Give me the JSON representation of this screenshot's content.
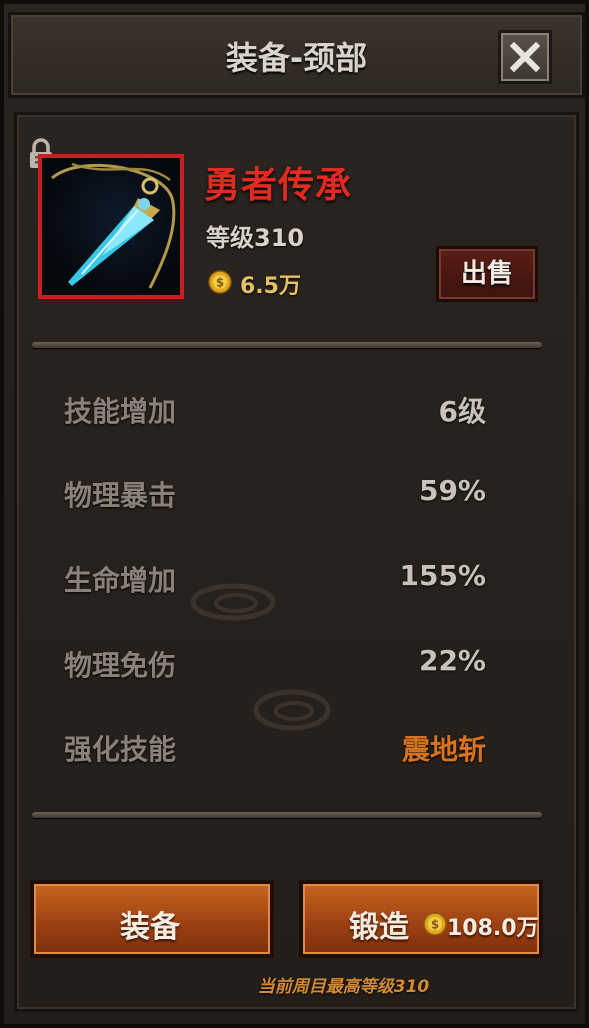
{
  "dialog": {
    "title": "装备-颈部"
  },
  "item": {
    "name": "勇者传承",
    "level": "等级310",
    "price": "6.5万",
    "name_color": "#e02a22",
    "frame_color": "#c82020",
    "icon": "crystal-pendant-icon"
  },
  "sell_label": "出售",
  "stats": [
    {
      "label": "技能增加",
      "value": "6级"
    },
    {
      "label": "物理暴击",
      "value": "59%"
    },
    {
      "label": "生命增加",
      "value": "155%"
    },
    {
      "label": "物理免伤",
      "value": "22%"
    },
    {
      "label": "强化技能",
      "value": "震地斩"
    }
  ],
  "buttons": {
    "equip_label": "装备",
    "forge_label": "锻造",
    "forge_cost": "108.0万"
  },
  "footer_note": "当前周目最高等级310"
}
